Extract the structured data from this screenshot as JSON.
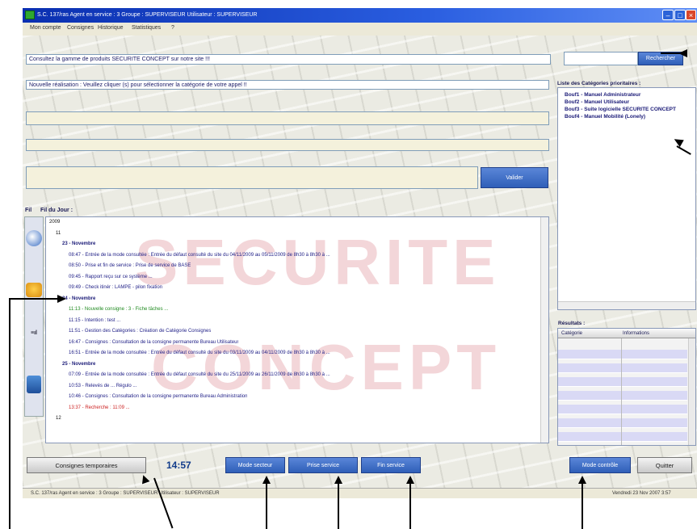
{
  "window": {
    "title": "S.C. 137/ras  Agent en service : 3   Groupe : SUPERVISEUR   Utilisateur : SUPERVISEUR"
  },
  "menu": [
    "Mon compte",
    "Consignes",
    "Historique",
    "Statistiques",
    "?"
  ],
  "header_message": "Consultez la gamme de produits SECURITE CONCEPT sur notre site !!!",
  "search_button_label": "Rechercher",
  "incoming_call_text": "Nouvelle réalisation : Veuillez cliquer (s) pour sélectionner la catégorie de votre appel !!",
  "send_button_label": "Valider",
  "panels": {
    "tree_label": "Fil du Jour :",
    "side_prefix": "Fil"
  },
  "tree": [
    {
      "text": "2009",
      "color": "#111111"
    },
    {
      "text": "11",
      "color": "#111111"
    },
    {
      "text": "23 - Novembre",
      "color": "#1a1a77",
      "bold": true
    },
    {
      "text": "08:47 - Entrée de la mode consultée : Entrée du défaut consulté du site  du 04/11/2009 au 05/11/2009 de 8h30 à 8h30 à ...",
      "color": "#222288"
    },
    {
      "text": "08:50 - Prise et fin de service : Prise de service de BASE",
      "color": "#222288"
    },
    {
      "text": "09:45 - Rapport reçu sur ce système ...",
      "color": "#222288"
    },
    {
      "text": "09:49 - Check itinér : LAMPE - pilon fixation",
      "color": "#222288"
    },
    {
      "text": "24 - Novembre",
      "color": "#1a1a77",
      "bold": true
    },
    {
      "text": "11:13 - Nouvelle consigne : 3 - Fiche tâches ...",
      "color": "#1f8a1f"
    },
    {
      "text": "11:15 - Intention : test ...",
      "color": "#222288"
    },
    {
      "text": "11:51 - Gestion des Catégories : Création de Catégorie Consignes",
      "color": "#222288"
    },
    {
      "text": "16:47 - Consignes : Consultation de la consigne permanente Bureau Utilisateur",
      "color": "#222288"
    },
    {
      "text": "16:51 - Entrée de la mode consultée : Entrée du défaut consulté du site  du 03/11/2009 au 04/11/2009 de 8h30 à 8h30 à ...",
      "color": "#222288"
    },
    {
      "text": "25 - Novembre",
      "color": "#1a1a77",
      "bold": true
    },
    {
      "text": "07:09 - Entrée de la mode consultée : Entrée du défaut consulté du site  du 25/11/2009 au 26/11/2009 de 8h30 à 8h30 à ...",
      "color": "#222288"
    },
    {
      "text": "10:53 - Relevés de ... Régulo ...",
      "color": "#222288"
    },
    {
      "text": "10:46 - Consignes : Consultation de la consigne permanente Bureau Administration",
      "color": "#222288"
    },
    {
      "text": "13:37 - Recherche : 11:09 ...",
      "color": "#cc2222"
    },
    {
      "text": "12",
      "color": "#111111"
    }
  ],
  "watermark": [
    "SECURITE",
    "CONCEPT"
  ],
  "right_panel": {
    "list_label": "Liste des Catégories prioritaires :",
    "items": [
      "Bouf1 - Manuel Administrateur",
      "Bouf2 - Manuel Utilisateur",
      "Bouf3 - Suite logicielle SECURITE CONCEPT",
      "Bouf4 - Manuel Mobilité (Lonely)"
    ],
    "grid_label": "Résultats :",
    "grid_headers": [
      "Catégorie",
      "Informations"
    ],
    "grid_rows": 7
  },
  "toolbar": {
    "temp_orders": "Consignes temporaires",
    "clock": "14:57",
    "btn1": "Mode secteur",
    "btn2": "Prise service",
    "btn3": "Fin service",
    "btn4": "Mode contrôle",
    "quit": "Quitter"
  },
  "statusbar": {
    "left": "S.C. 137/ras  Agent en service : 3   Groupe : SUPERVISEUR   Utilisateur : SUPERVISEUR",
    "right": "Vendredi 23 Nov 2007 3:57"
  },
  "colors": {
    "titlebar": "#0a2fb0",
    "button_blue": "#2f5fb8",
    "menubar": "#ece9d8",
    "grid_purple": "#d9d9f5"
  }
}
